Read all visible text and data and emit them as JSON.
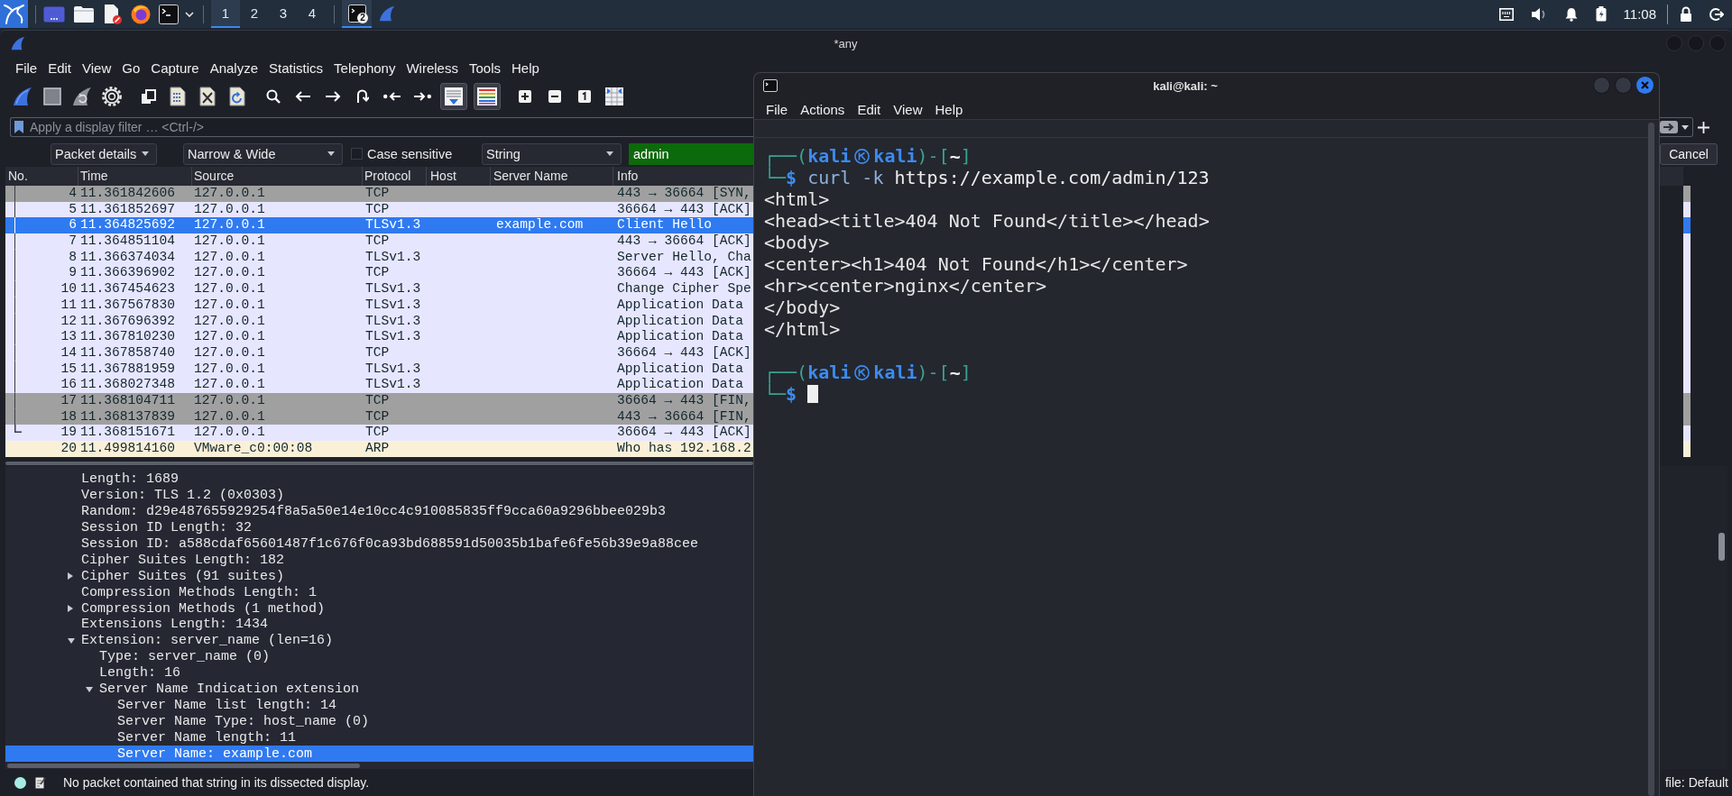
{
  "taskbar": {
    "workspaces": [
      {
        "label": "1",
        "selected": true
      },
      {
        "label": "2",
        "selected": false
      },
      {
        "label": "3",
        "selected": false
      },
      {
        "label": "4",
        "selected": false
      }
    ],
    "tasks": [
      {
        "kind": "terminal",
        "badge": "2",
        "selected": true
      },
      {
        "kind": "wireshark",
        "selected": false
      }
    ],
    "clock": "11:08"
  },
  "wireshark": {
    "title": "*any",
    "menu": [
      "File",
      "Edit",
      "View",
      "Go",
      "Capture",
      "Analyze",
      "Statistics",
      "Telephony",
      "Wireless",
      "Tools",
      "Help"
    ],
    "toolbar": {
      "auto_scroll": {
        "checked": true
      },
      "colorize": {
        "checked": true
      }
    },
    "filter": {
      "placeholder": "Apply a display filter … <Ctrl-/>"
    },
    "find_bar": {
      "search_in": "Packet details",
      "character_width": "Narrow & Wide",
      "case_sensitive": {
        "label": "Case sensitive",
        "checked": false
      },
      "search_type": "String",
      "query": "admin",
      "cancel": "Cancel"
    },
    "packet_list": {
      "columns": [
        "No.",
        "Time",
        "Source",
        "Protocol",
        "Host",
        "Server Name",
        "Info"
      ],
      "rows": [
        {
          "kind": "middle",
          "no": "4",
          "time": "11.361842606",
          "source": "127.0.0.1",
          "protocol": "TCP",
          "info": "443 → 36664 [SYN,",
          "color": "#a0a0a0",
          "selected": false
        },
        {
          "kind": "middle",
          "no": "5",
          "time": "11.361852697",
          "source": "127.0.0.1",
          "protocol": "TCP",
          "info": "36664 → 443 [ACK]",
          "color": "#e7e6ff",
          "selected": false
        },
        {
          "kind": "middle",
          "no": "6",
          "time": "11.364825692",
          "source": "127.0.0.1",
          "protocol": "TLSv1.3",
          "server_name": "example.com",
          "info": "Client Hello",
          "selected": true
        },
        {
          "kind": "middle",
          "no": "7",
          "time": "11.364851104",
          "source": "127.0.0.1",
          "protocol": "TCP",
          "info": "443 → 36664 [ACK]",
          "color": "#e7e6ff",
          "selected": false
        },
        {
          "kind": "middle",
          "no": "8",
          "time": "11.366374034",
          "source": "127.0.0.1",
          "protocol": "TLSv1.3",
          "info": "Server Hello, Cha",
          "color": "#e7e6ff",
          "selected": false
        },
        {
          "kind": "middle",
          "no": "9",
          "time": "11.366396902",
          "source": "127.0.0.1",
          "protocol": "TCP",
          "info": "36664 → 443 [ACK]",
          "color": "#e7e6ff",
          "selected": false
        },
        {
          "kind": "middle",
          "no": "10",
          "time": "11.367454623",
          "source": "127.0.0.1",
          "protocol": "TLSv1.3",
          "info": "Change Cipher Spe",
          "color": "#e7e6ff",
          "selected": false
        },
        {
          "kind": "middle",
          "no": "11",
          "time": "11.367567830",
          "source": "127.0.0.1",
          "protocol": "TLSv1.3",
          "info": "Application Data",
          "color": "#e7e6ff",
          "selected": false
        },
        {
          "kind": "middle",
          "no": "12",
          "time": "11.367696392",
          "source": "127.0.0.1",
          "protocol": "TLSv1.3",
          "info": "Application Data",
          "color": "#e7e6ff",
          "selected": false
        },
        {
          "kind": "middle",
          "no": "13",
          "time": "11.367810230",
          "source": "127.0.0.1",
          "protocol": "TLSv1.3",
          "info": "Application Data",
          "color": "#e7e6ff",
          "selected": false
        },
        {
          "kind": "middle",
          "no": "14",
          "time": "11.367858740",
          "source": "127.0.0.1",
          "protocol": "TCP",
          "info": "36664 → 443 [ACK]",
          "color": "#e7e6ff",
          "selected": false
        },
        {
          "kind": "middle",
          "no": "15",
          "time": "11.367881959",
          "source": "127.0.0.1",
          "protocol": "TLSv1.3",
          "info": "Application Data",
          "color": "#e7e6ff",
          "selected": false
        },
        {
          "kind": "middle",
          "no": "16",
          "time": "11.368027348",
          "source": "127.0.0.1",
          "protocol": "TLSv1.3",
          "info": "Application Data",
          "color": "#e7e6ff",
          "selected": false
        },
        {
          "kind": "middle",
          "no": "17",
          "time": "11.368104711",
          "source": "127.0.0.1",
          "protocol": "TCP",
          "info": "36664 → 443 [FIN,",
          "color": "#a0a0a0",
          "selected": false
        },
        {
          "kind": "middle",
          "no": "18",
          "time": "11.368137839",
          "source": "127.0.0.1",
          "protocol": "TCP",
          "info": "443 → 36664 [FIN,",
          "color": "#a0a0a0",
          "selected": false
        },
        {
          "kind": "end",
          "no": "19",
          "time": "11.368151671",
          "source": "127.0.0.1",
          "protocol": "TCP",
          "info": "36664 → 443 [ACK]",
          "color": "#e7e6ff",
          "selected": false
        },
        {
          "kind": "plain",
          "no": "20",
          "time": "11.499814160",
          "source": "VMware_c0:00:08",
          "protocol": "ARP",
          "info": "Who has 192.168.2",
          "color": "#faf0d7",
          "selected": false
        }
      ]
    },
    "packet_details": [
      {
        "text": "Length: 1689",
        "selected": false
      },
      {
        "text": "Version: TLS 1.2 (0x0303)",
        "selected": false
      },
      {
        "text": "Random: d29e487655929254f8a5a50e14e10cc4c910085835ff9cca60a9296bbee029b3",
        "selected": false
      },
      {
        "text": "Session ID Length: 32",
        "selected": false
      },
      {
        "text": "Session ID: a588cdaf65601487f1c676f0ca93bd688591d50035b1bafe6fe56b39e9a88cee",
        "selected": false
      },
      {
        "text": "Cipher Suites Length: 182",
        "selected": false
      },
      {
        "text": "Cipher Suites (91 suites)",
        "expanded": false,
        "selected": false
      },
      {
        "text": "Compression Methods Length: 1",
        "selected": false
      },
      {
        "text": "Compression Methods (1 method)",
        "expanded": false,
        "selected": false
      },
      {
        "text": "Extensions Length: 1434",
        "selected": false
      },
      {
        "text": "Extension: server_name (len=16)",
        "expanded": true,
        "selected": false,
        "children": [
          {
            "text": "Type: server_name (0)",
            "selected": false
          },
          {
            "text": "Length: 16",
            "selected": false
          },
          {
            "text": "Server Name Indication extension",
            "expanded": true,
            "selected": false,
            "children": [
              {
                "text": "Server Name list length: 14",
                "selected": false
              },
              {
                "text": "Server Name Type: host_name (0)",
                "selected": false
              },
              {
                "text": "Server Name length: 11",
                "selected": false
              },
              {
                "text": "Server Name: example.com",
                "selected": true
              }
            ]
          }
        ]
      }
    ],
    "status_bar": {
      "message": "No packet contained that string in its dissected display.",
      "profile": "file: Default"
    }
  },
  "terminal": {
    "title": "kali@kali: ~",
    "menu": [
      "File",
      "Actions",
      "Edit",
      "View",
      "Help"
    ],
    "lines": [
      {
        "kind": "prompt",
        "open": "┌──(",
        "user": "kali",
        "host": "kali",
        "middle": ")-[",
        "directory": "~",
        "close": "]"
      },
      {
        "kind": "command",
        "lead": "└─",
        "sign": "$",
        "program": "curl -k",
        "argument": "https://example.com/admin/123"
      },
      {
        "kind": "output",
        "text": "<html>"
      },
      {
        "kind": "output",
        "text": "<head><title>404 Not Found</title></head>"
      },
      {
        "kind": "output",
        "text": "<body>"
      },
      {
        "kind": "output",
        "text": "<center><h1>404 Not Found</h1></center>"
      },
      {
        "kind": "output",
        "text": "<hr><center>nginx</center>"
      },
      {
        "kind": "output",
        "text": "</body>"
      },
      {
        "kind": "output",
        "text": "</html>"
      },
      {
        "kind": "blank"
      },
      {
        "kind": "prompt",
        "open": "┌──(",
        "user": "kali",
        "host": "kali",
        "middle": ")-[",
        "directory": "~",
        "close": "]"
      },
      {
        "kind": "command",
        "lead": "└─",
        "sign": "$",
        "cursor": true
      }
    ]
  }
}
